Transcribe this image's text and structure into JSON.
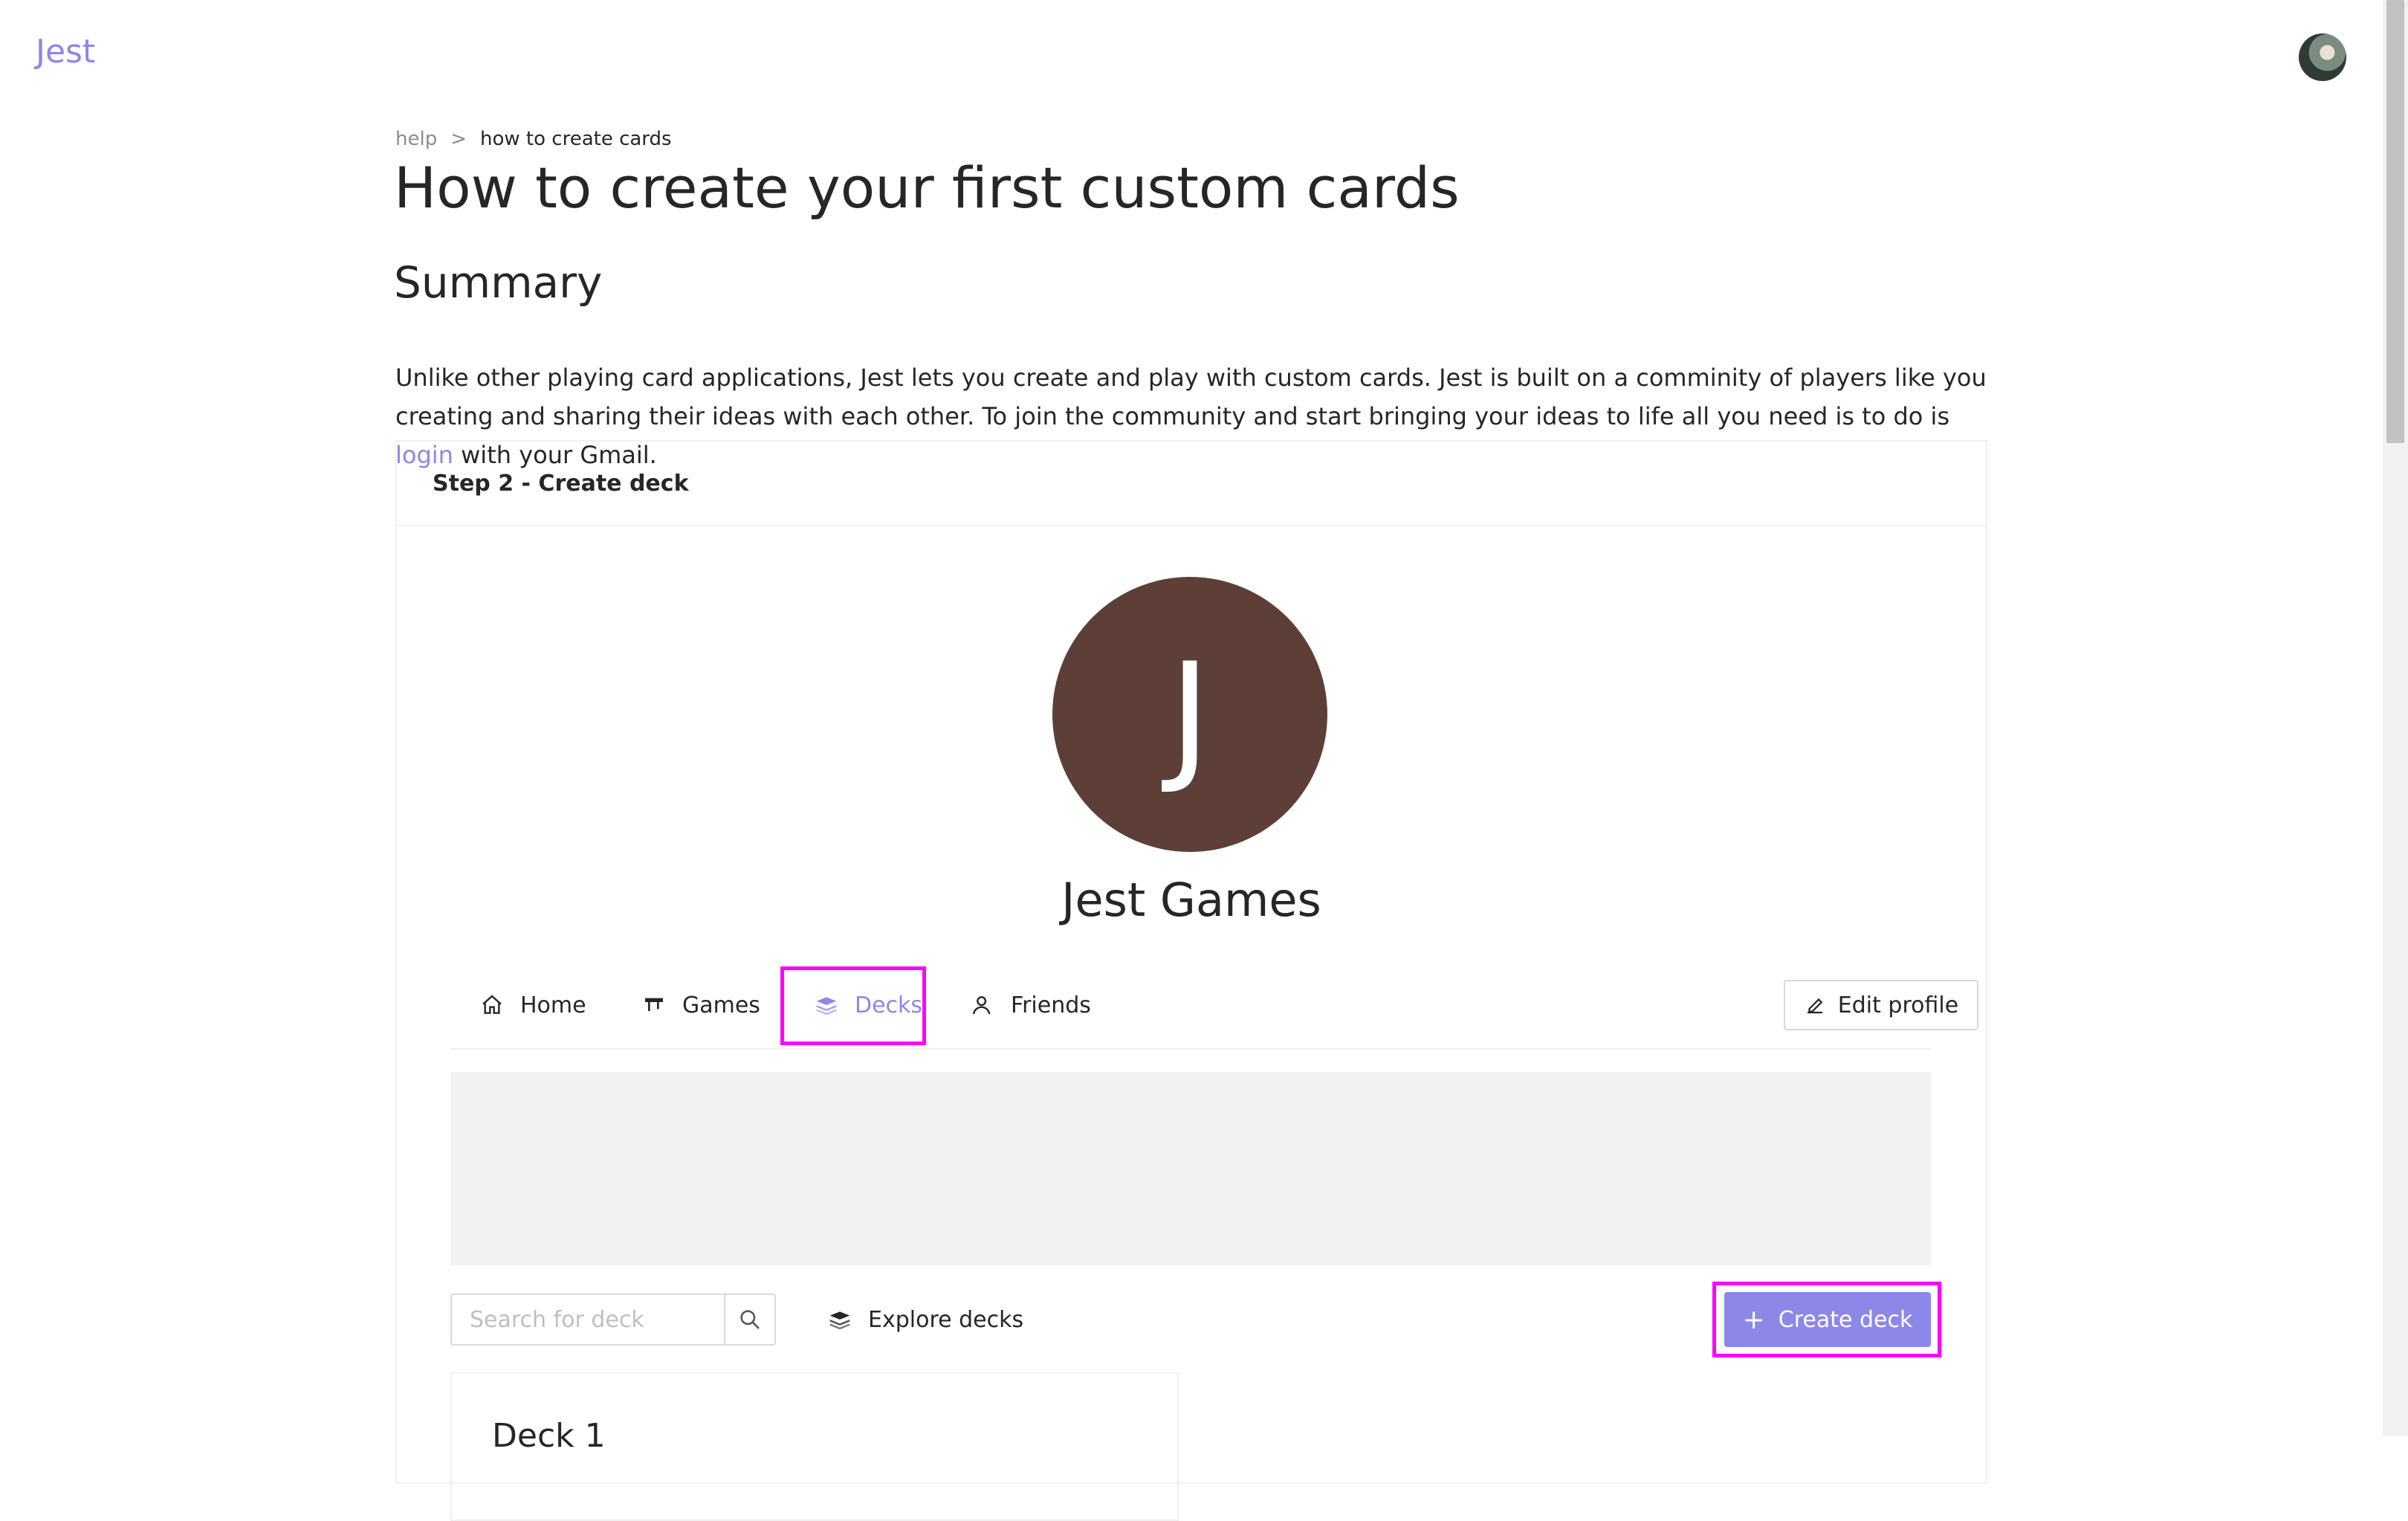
{
  "app": {
    "logo": "Jest"
  },
  "breadcrumb": {
    "items": [
      "help",
      "how to create cards"
    ],
    "separator": ">"
  },
  "page": {
    "title": "How to create your first custom cards",
    "summary_heading": "Summary",
    "summary_text_1": "Unlike other playing card applications, Jest lets you create and play with custom cards. Jest is built on a comminity of players like you creating and sharing their ideas with each other. To join the community and start bringing your ideas to life all you need is to do is ",
    "summary_link": "login",
    "summary_text_2": " with your Gmail."
  },
  "step_card": {
    "title": "Step 2 - Create deck",
    "profile": {
      "initial": "J",
      "name": "Jest Games",
      "avatar_color": "#5d3f37"
    },
    "tabs": [
      {
        "label": "Home",
        "icon": "home-icon"
      },
      {
        "label": "Games",
        "icon": "games-icon"
      },
      {
        "label": "Decks",
        "icon": "decks-icon",
        "active": true
      },
      {
        "label": "Friends",
        "icon": "friends-icon"
      }
    ],
    "edit_profile_label": "Edit profile",
    "search": {
      "placeholder": "Search for deck"
    },
    "explore_label": "Explore decks",
    "create_label": "Create deck",
    "deck_title": "Deck 1"
  },
  "colors": {
    "accent": "#8d87e8",
    "highlight": "#ff00ff",
    "banner": "#f2f2f2"
  }
}
